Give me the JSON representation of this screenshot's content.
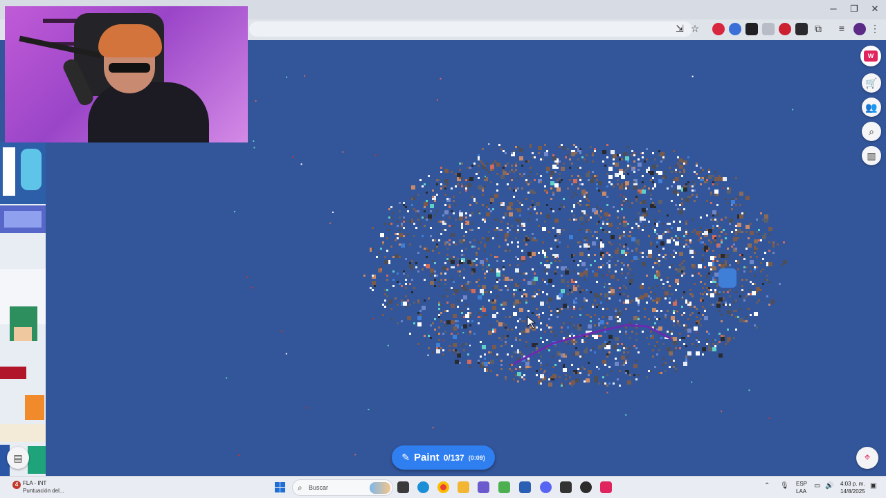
{
  "window_controls": {
    "minimize": "─",
    "restore": "❐",
    "close": "✕"
  },
  "map": {
    "paint_button": {
      "icon": "brush-icon",
      "label": "Paint",
      "count": "0/137",
      "timer": "(0:09)"
    },
    "right_toolbar": [
      {
        "name": "store-icon",
        "glyph": "🛒"
      },
      {
        "name": "alliance-icon",
        "glyph": "👥"
      },
      {
        "name": "search-location-icon",
        "glyph": "⌕"
      },
      {
        "name": "leaderboard-icon",
        "glyph": "▥"
      }
    ],
    "colors": {
      "ocean": "#33559a",
      "accent": "#2f7ff0",
      "brand": "#e0245e"
    }
  },
  "taskbar": {
    "notification_title": "FLA - INT",
    "notification_sub": "Puntuación del...",
    "notification_count": "4",
    "search_placeholder": "Buscar",
    "language_1": "ESP",
    "language_2": "LAA",
    "time": "4:03 p. m.",
    "date": "14/8/2025"
  }
}
